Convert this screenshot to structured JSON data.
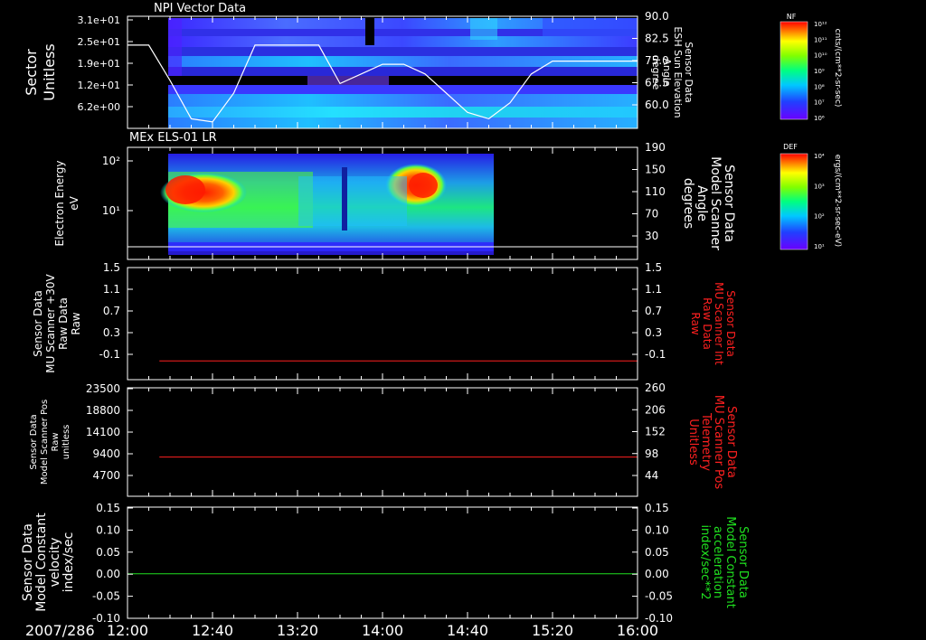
{
  "date_label": "2007/286",
  "time_ticks": [
    "12:00",
    "12:40",
    "13:20",
    "14:00",
    "14:40",
    "15:20",
    "16:00"
  ],
  "colors": {
    "red_axis": "#ff2020",
    "green_axis": "#20e020",
    "white": "#ffffff",
    "frame": "#ffffff"
  },
  "panels": [
    {
      "id": "npi",
      "title": "NPI Vector Data",
      "left_label": [
        "Sector",
        "Unitless"
      ],
      "left_ticks": [
        "3.1e+01",
        "2.5e+01",
        "1.9e+01",
        "1.2e+01",
        "6.2e+00"
      ],
      "right_label": [
        "Sensor Data",
        "ESH Sun Elevation",
        "Angle",
        "degree"
      ],
      "right_ticks": [
        "90.0",
        "82.5",
        "75.0",
        "67.5",
        "60.0"
      ]
    },
    {
      "id": "els",
      "title": "MEx ELS-01 LR",
      "left_label": [
        "Electron Energy",
        "eV"
      ],
      "left_ticks": [
        "10²",
        "10¹"
      ],
      "right_label": [
        "Sensor Data",
        "Model Scanner",
        "Angle",
        "degrees"
      ],
      "right_ticks": [
        "190",
        "150",
        "110",
        "70",
        "30"
      ]
    },
    {
      "id": "mu30",
      "title": "",
      "left_label": [
        "Sensor Data",
        "MU Scanner +30V",
        "Raw Data",
        "Raw"
      ],
      "left_ticks": [
        "1.5",
        "1.1",
        "0.7",
        "0.3",
        "-0.1"
      ],
      "right_label": [
        "Sensor Data",
        "MU Scanner Int",
        "Raw Data",
        "Raw"
      ],
      "right_ticks": [
        "1.5",
        "1.1",
        "0.7",
        "0.3",
        "-0.1"
      ]
    },
    {
      "id": "pos",
      "title": "",
      "left_label": [
        "Sensor Data",
        "Model Scanner Pos",
        "Raw",
        "unitless"
      ],
      "left_ticks": [
        "23500",
        "18800",
        "14100",
        "9400",
        "4700"
      ],
      "right_label": [
        "Sensor Data",
        "MU Scanner Pos",
        "Telemetry",
        "Unitless"
      ],
      "right_ticks": [
        "260",
        "206",
        "152",
        "98",
        "44"
      ]
    },
    {
      "id": "vel",
      "title": "",
      "left_label": [
        "Sensor Data",
        "Model Constant",
        "velocity",
        "index/sec"
      ],
      "left_ticks": [
        "0.15",
        "0.10",
        "0.05",
        "0.00",
        "-0.05",
        "-0.10"
      ],
      "right_label": [
        "Sensor Data",
        "Model Constant",
        "acceleration",
        "index/sec**2"
      ],
      "right_ticks": [
        "0.15",
        "0.10",
        "0.05",
        "0.00",
        "-0.05",
        "-0.10"
      ]
    }
  ],
  "colorbars": [
    {
      "label_top": "NF",
      "units": "cnts/(cm**2-sr-sec)",
      "ticks": [
        "10¹²",
        "10¹¹",
        "10¹⁰",
        "10⁹",
        "10⁸",
        "10⁷",
        "10⁶"
      ]
    },
    {
      "label_top": "DEF",
      "units": "ergs/(cm**2-sr-sec-eV)",
      "ticks": [
        "10⁴",
        "10³",
        "10²",
        "10¹"
      ]
    }
  ],
  "chart_data": [
    {
      "type": "heatmap",
      "title": "NPI Vector Data",
      "ylabel": "Sector Unitless",
      "y2label": "Sensor Data ESH Sun Elevation Angle degree",
      "x_range": [
        "12:00",
        "16:00"
      ],
      "y2lim": [
        55,
        90
      ],
      "series": [
        {
          "name": "ESH Sun Elevation Angle",
          "x_min": [
            0,
            10,
            20,
            30,
            40,
            50,
            60,
            70,
            80,
            90,
            100,
            110,
            120,
            130,
            140,
            150,
            160,
            170,
            180,
            190,
            200,
            210,
            220,
            230,
            240
          ],
          "values": [
            81,
            81,
            70,
            58,
            57,
            66,
            81,
            81,
            81,
            81,
            69,
            72,
            75,
            75,
            72,
            66,
            60,
            58,
            63,
            72,
            76,
            76,
            76,
            76,
            76
          ]
        }
      ]
    },
    {
      "type": "heatmap",
      "title": "MEx ELS-01 LR",
      "ylabel": "Electron Energy eV",
      "y2label": "Sensor Data Model Scanner Angle degrees",
      "y2lim": [
        0,
        190
      ],
      "series": [
        {
          "name": "Model Scanner Angle",
          "x_min": [
            0,
            240
          ],
          "values": [
            13,
            13
          ]
        }
      ]
    },
    {
      "type": "line",
      "ylabel": "Sensor Data MU Scanner +30V Raw Data Raw",
      "ylim": [
        -0.3,
        1.5
      ],
      "series": [
        {
          "name": "MU Scanner Int Raw Data",
          "x_min": [
            0,
            240
          ],
          "values": [
            0.0,
            0.0
          ]
        }
      ]
    },
    {
      "type": "line",
      "ylabel": "Sensor Data Model Scanner Pos Raw unitless",
      "ylim": [
        0,
        23500
      ],
      "series": [
        {
          "name": "MU Scanner Pos Telemetry",
          "x_min": [
            0,
            240
          ],
          "values": [
            8500,
            8500
          ]
        }
      ]
    },
    {
      "type": "line",
      "ylabel": "Sensor Data Model Constant velocity index/sec",
      "ylim": [
        -0.1,
        0.15
      ],
      "series": [
        {
          "name": "Model Constant velocity",
          "x_min": [
            0,
            240
          ],
          "values": [
            0.0,
            0.0
          ]
        }
      ]
    }
  ]
}
